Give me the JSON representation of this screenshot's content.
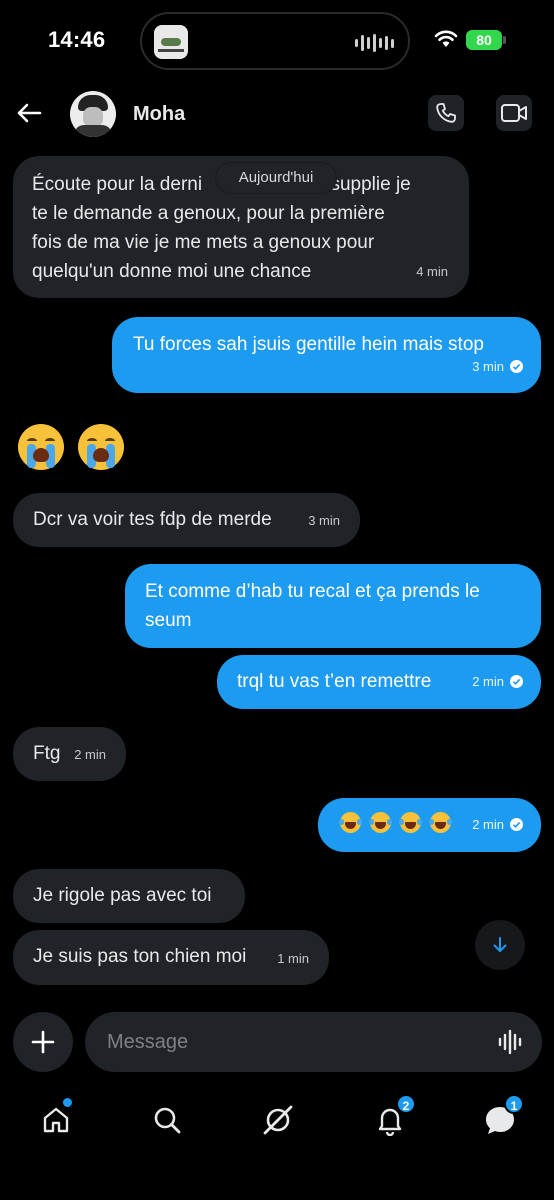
{
  "status_bar": {
    "time": "14:46",
    "battery": "80"
  },
  "header": {
    "contact_name": "Moha"
  },
  "day_separator": "Aujourd'hui",
  "messages": [
    {
      "dir": "in",
      "lines": [
        "Écoute pour la derni",
        "te le demande a genoux, pour la première",
        "fois de ma vie je me mets a genoux pour",
        "quelqu'un donne moi une chance"
      ],
      "line1_end": "en supplie je",
      "time": "4 min"
    },
    {
      "dir": "out",
      "text": "Tu forces sah jsuis gentille hein mais stop",
      "time": "3 min"
    },
    {
      "dir": "in",
      "type": "emoji",
      "emoji": "loudly-crying-face x2"
    },
    {
      "dir": "in",
      "text": "Dcr va voir tes fdp de merde",
      "time": "3 min"
    },
    {
      "dir": "out",
      "lines": [
        "Et comme d’hab tu recal et ça prends le",
        "seum"
      ]
    },
    {
      "dir": "out",
      "text": "trql tu vas t’en remettre",
      "time": "2 min"
    },
    {
      "dir": "in",
      "text": "Ftg",
      "time": "2 min"
    },
    {
      "dir": "out",
      "type": "emoji",
      "emoji": "face-with-tears-of-joy x4",
      "time": "2 min"
    },
    {
      "dir": "in",
      "text": "Je rigole pas avec toi"
    },
    {
      "dir": "in",
      "text": "Je suis pas ton chien moi",
      "time": "1 min"
    }
  ],
  "composer": {
    "placeholder": "Message"
  },
  "tabbar": {
    "notifications_badge": "2",
    "messages_badge": "1"
  },
  "colors": {
    "outgoing": "#1d9bf0",
    "incoming": "#202327",
    "background": "#000000"
  }
}
